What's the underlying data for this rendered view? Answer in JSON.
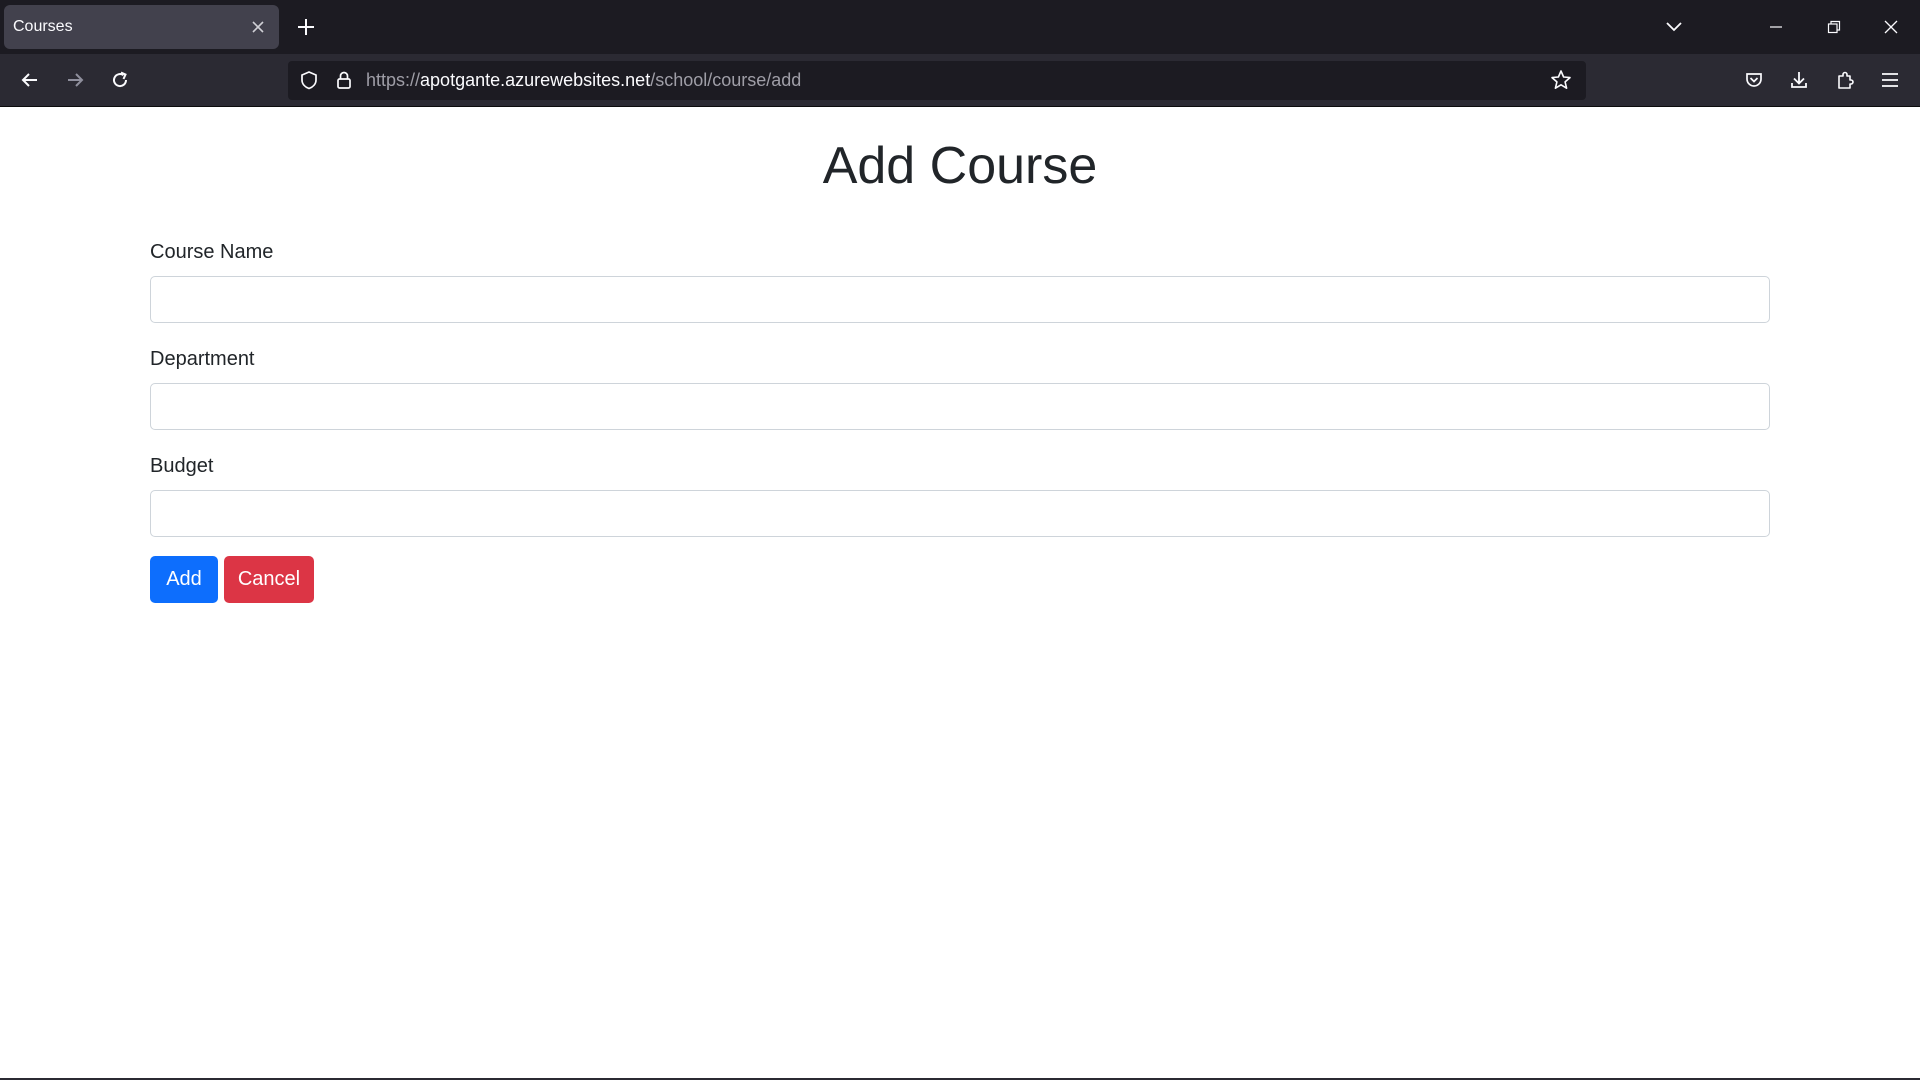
{
  "browser": {
    "tab": {
      "title": "Courses"
    },
    "url": {
      "scheme": "https://",
      "host": "apotgante.azurewebsites.net",
      "path": "/school/course/add"
    },
    "icons": {
      "tab_close": "close-icon",
      "new_tab": "plus-icon",
      "tab_list": "chevron-down-icon",
      "back": "arrow-left-icon",
      "forward": "arrow-right-icon",
      "reload": "reload-icon",
      "tracking_protection": "shield-icon",
      "site_security": "lock-icon",
      "bookmark": "star-icon",
      "pocket": "pocket-icon",
      "downloads": "download-icon",
      "extensions": "puzzle-icon",
      "menu": "hamburger-menu-icon",
      "minimize": "minimize-icon",
      "restore": "restore-icon",
      "window_close": "close-icon"
    },
    "colors": {
      "tabbar_bg": "#1c1b22",
      "active_tab_bg": "#42414d",
      "navbar_bg": "#2b2a33",
      "urlbar_bg": "#1c1b22"
    }
  },
  "page": {
    "title": "Add Course",
    "form": {
      "course_name": {
        "label": "Course Name",
        "value": "",
        "placeholder": ""
      },
      "department": {
        "label": "Department",
        "value": "",
        "placeholder": ""
      },
      "budget": {
        "label": "Budget",
        "value": "",
        "placeholder": ""
      }
    },
    "buttons": {
      "add": "Add",
      "cancel": "Cancel"
    },
    "colors": {
      "primary": "#0d6efd",
      "danger": "#dc3545",
      "text": "#212529",
      "input_border": "#ced4da"
    }
  }
}
